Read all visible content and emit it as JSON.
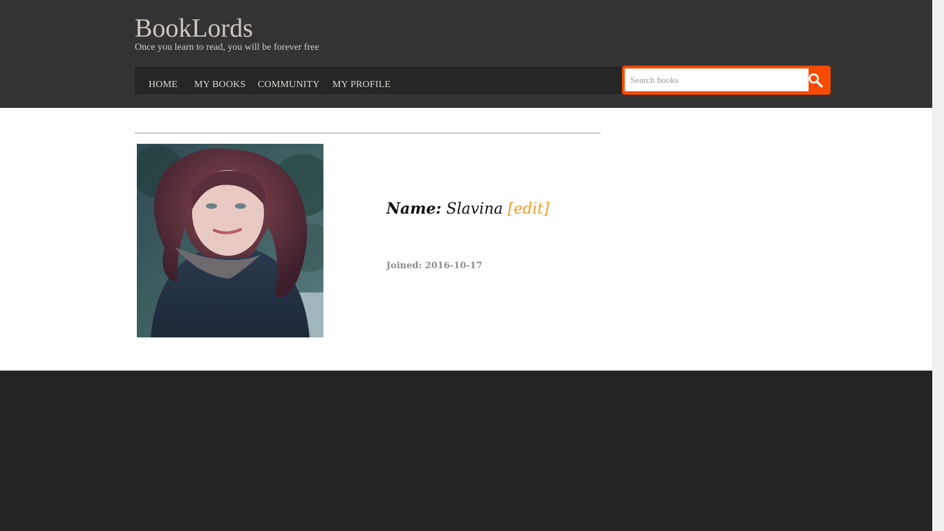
{
  "site": {
    "title": "BookLords",
    "tagline": "Once you learn to read, you will be forever free"
  },
  "nav": {
    "items": [
      {
        "label": "HOME"
      },
      {
        "label": "MY BOOKS"
      },
      {
        "label": "COMMUNITY"
      },
      {
        "label": "MY PROFILE"
      }
    ]
  },
  "search": {
    "placeholder": "Search books",
    "value": "",
    "icon": "search-icon"
  },
  "profile": {
    "name_label": "Name:",
    "name_value": "Slavina",
    "edit_label": "[edit]",
    "joined_text": "Joined: 2016-10-17"
  },
  "colors": {
    "header_bg": "#333333",
    "nav_bg": "#262626",
    "accent": "#f64a00",
    "edit_link": "#f39a24",
    "footer_bg": "#242424"
  }
}
